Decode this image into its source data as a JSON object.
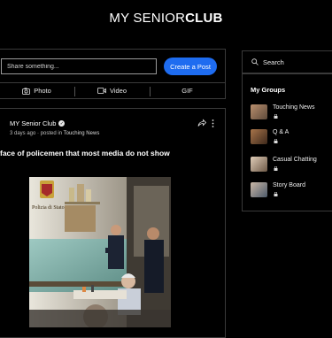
{
  "header": {
    "logo_thin": "MY SENIOR",
    "logo_bold": "CLUB"
  },
  "composer": {
    "placeholder": "Share something...",
    "create_button": "Create a Post",
    "accent_color": "#1e6cf0"
  },
  "media_bar": {
    "photo": "Photo",
    "video": "Video",
    "gif": "GIF"
  },
  "post": {
    "author": "MY Senior Club",
    "time": "3 days ago",
    "posted_in_prefix": "· posted in",
    "category": "Touching News",
    "title": "face of policemen that most media do not show",
    "image_caption": "Polizia di Stato"
  },
  "sidebar": {
    "search_label": "Search",
    "groups_title": "My Groups",
    "groups": [
      {
        "name": "Touching News",
        "icon": "lock-icon"
      },
      {
        "name": "Q & A",
        "icon": "lock-icon"
      },
      {
        "name": "Casual Chatting",
        "icon": "lock-icon"
      },
      {
        "name": "Story Board",
        "icon": "lock-icon"
      }
    ]
  }
}
